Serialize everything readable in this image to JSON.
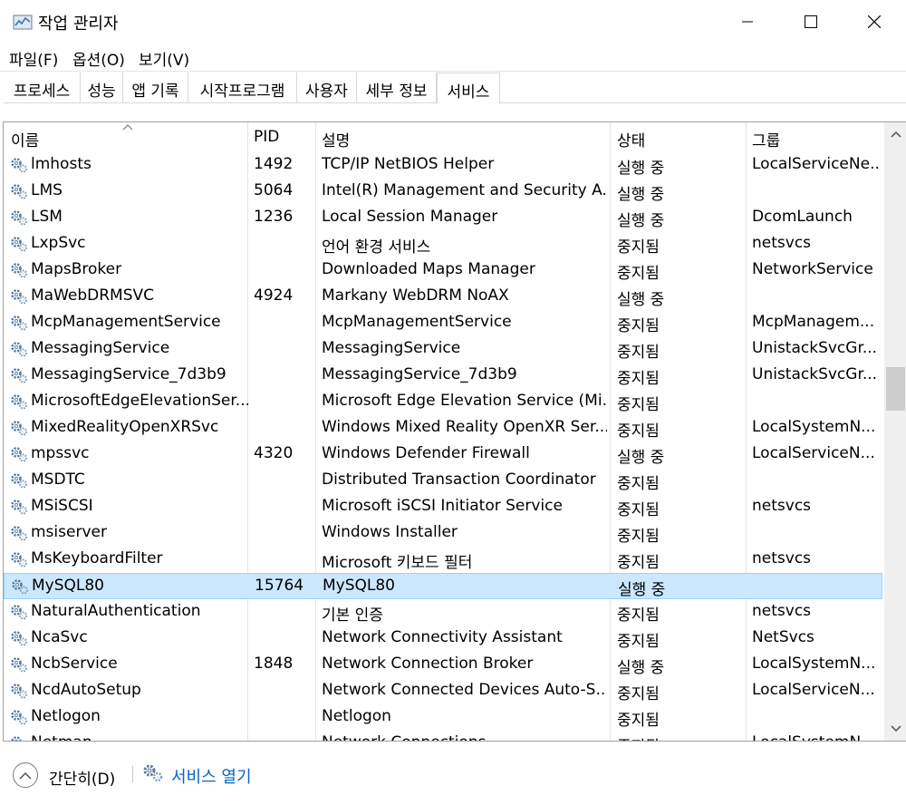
{
  "window": {
    "title": "작업 관리자",
    "minimize_glyph": "—",
    "maximize_glyph": "☐",
    "close_glyph": "✕"
  },
  "menu": [
    "파일(F)",
    "옵션(O)",
    "보기(V)"
  ],
  "tabs": [
    {
      "label": "프로세스",
      "active": false
    },
    {
      "label": "성능",
      "active": false
    },
    {
      "label": "앱 기록",
      "active": false
    },
    {
      "label": "시작프로그램",
      "active": false
    },
    {
      "label": "사용자",
      "active": false
    },
    {
      "label": "세부 정보",
      "active": false
    },
    {
      "label": "서비스",
      "active": true
    }
  ],
  "columns": {
    "name": "이름",
    "pid": "PID",
    "desc": "설명",
    "status": "상태",
    "group": "그룹"
  },
  "rows": [
    {
      "name": "lmhosts",
      "pid": "1492",
      "desc": "TCP/IP NetBIOS Helper",
      "status": "실행 중",
      "group": "LocalServiceNe..."
    },
    {
      "name": "LMS",
      "pid": "5064",
      "desc": "Intel(R) Management and Security A...",
      "status": "실행 중",
      "group": ""
    },
    {
      "name": "LSM",
      "pid": "1236",
      "desc": "Local Session Manager",
      "status": "실행 중",
      "group": "DcomLaunch"
    },
    {
      "name": "LxpSvc",
      "pid": "",
      "desc": "언어 환경 서비스",
      "status": "중지됨",
      "group": "netsvcs"
    },
    {
      "name": "MapsBroker",
      "pid": "",
      "desc": "Downloaded Maps Manager",
      "status": "중지됨",
      "group": "NetworkService"
    },
    {
      "name": "MaWebDRMSVC",
      "pid": "4924",
      "desc": "Markany WebDRM NoAX",
      "status": "실행 중",
      "group": ""
    },
    {
      "name": "McpManagementService",
      "pid": "",
      "desc": "McpManagementService",
      "status": "중지됨",
      "group": "McpManagem..."
    },
    {
      "name": "MessagingService",
      "pid": "",
      "desc": "MessagingService",
      "status": "중지됨",
      "group": "UnistackSvcGr..."
    },
    {
      "name": "MessagingService_7d3b9",
      "pid": "",
      "desc": "MessagingService_7d3b9",
      "status": "중지됨",
      "group": "UnistackSvcGr..."
    },
    {
      "name": "MicrosoftEdgeElevationSer...",
      "pid": "",
      "desc": "Microsoft Edge Elevation Service (Mi...",
      "status": "중지됨",
      "group": ""
    },
    {
      "name": "MixedRealityOpenXRSvc",
      "pid": "",
      "desc": "Windows Mixed Reality OpenXR Ser...",
      "status": "중지됨",
      "group": "LocalSystemN..."
    },
    {
      "name": "mpssvc",
      "pid": "4320",
      "desc": "Windows Defender Firewall",
      "status": "실행 중",
      "group": "LocalServiceN..."
    },
    {
      "name": "MSDTC",
      "pid": "",
      "desc": "Distributed Transaction Coordinator",
      "status": "중지됨",
      "group": ""
    },
    {
      "name": "MSiSCSI",
      "pid": "",
      "desc": "Microsoft iSCSI Initiator Service",
      "status": "중지됨",
      "group": "netsvcs"
    },
    {
      "name": "msiserver",
      "pid": "",
      "desc": "Windows Installer",
      "status": "중지됨",
      "group": ""
    },
    {
      "name": "MsKeyboardFilter",
      "pid": "",
      "desc": "Microsoft 키보드 필터",
      "status": "중지됨",
      "group": "netsvcs"
    },
    {
      "name": "MySQL80",
      "pid": "15764",
      "desc": "MySQL80",
      "status": "실행 중",
      "group": "",
      "selected": true
    },
    {
      "name": "NaturalAuthentication",
      "pid": "",
      "desc": "기본 인증",
      "status": "중지됨",
      "group": "netsvcs"
    },
    {
      "name": "NcaSvc",
      "pid": "",
      "desc": "Network Connectivity Assistant",
      "status": "중지됨",
      "group": "NetSvcs"
    },
    {
      "name": "NcbService",
      "pid": "1848",
      "desc": "Network Connection Broker",
      "status": "실행 중",
      "group": "LocalSystemN..."
    },
    {
      "name": "NcdAutoSetup",
      "pid": "",
      "desc": "Network Connected Devices Auto-S...",
      "status": "중지됨",
      "group": "LocalServiceN..."
    },
    {
      "name": "Netlogon",
      "pid": "",
      "desc": "Netlogon",
      "status": "중지됨",
      "group": ""
    },
    {
      "name": "Netman",
      "pid": "",
      "desc": "Network Connections",
      "status": "중지됨",
      "group": "LocalSystemN..."
    }
  ],
  "footer": {
    "collapse_label": "간단히(D)",
    "open_services_label": "서비스 열기"
  },
  "colors": {
    "selected_bg": "#cce8ff",
    "selected_border": "#99d1ff",
    "link": "#0066cc"
  }
}
